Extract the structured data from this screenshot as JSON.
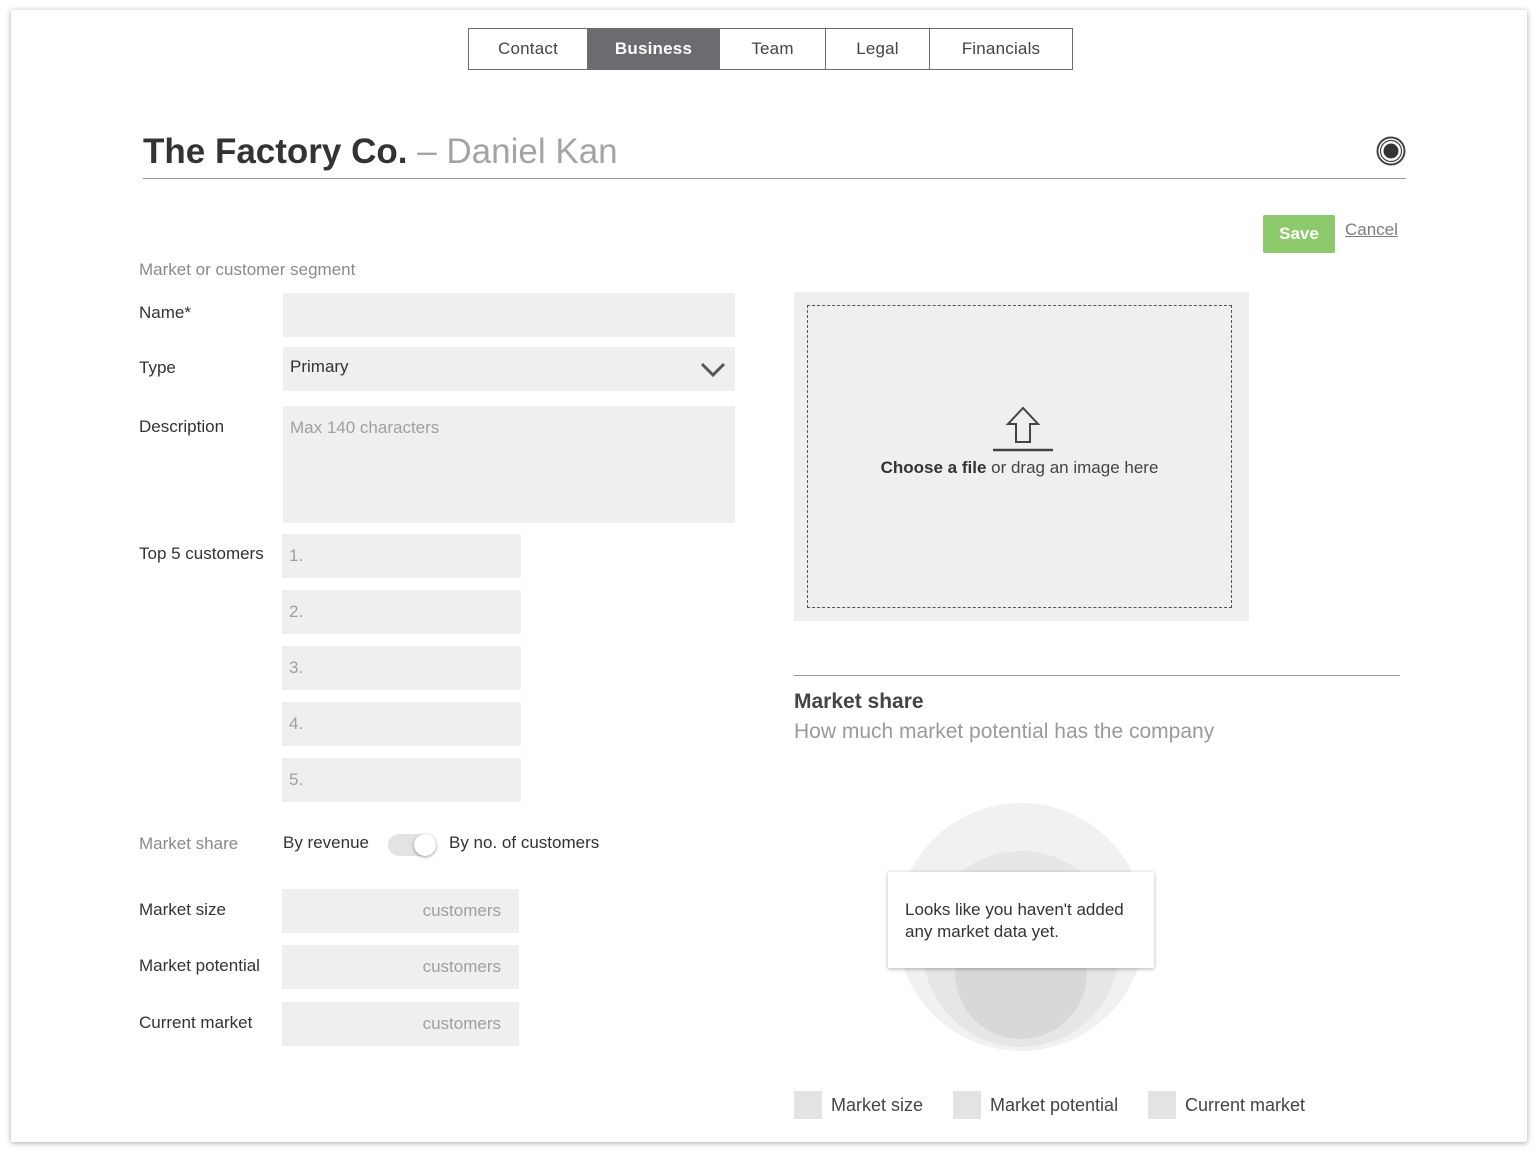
{
  "tabs": [
    {
      "label": "Contact",
      "active": false
    },
    {
      "label": "Business",
      "active": true
    },
    {
      "label": "Team",
      "active": false
    },
    {
      "label": "Legal",
      "active": false
    },
    {
      "label": "Financials",
      "active": false
    }
  ],
  "header": {
    "company": "The Factory Co.",
    "separator": " – ",
    "person": "Daniel Kan",
    "icon": "record-icon"
  },
  "actions": {
    "save_label": "Save",
    "cancel_label": "Cancel"
  },
  "form": {
    "section_label": "Market or customer segment",
    "name_label": "Name*",
    "name_value": "",
    "type_label": "Type",
    "type_value": "Primary",
    "description_label": "Description",
    "description_placeholder": "Max 140 characters",
    "top_customers_label": "Top 5 customers",
    "top_customers_placeholders": [
      "1.",
      "2.",
      "3.",
      "4.",
      "5."
    ],
    "market_share_label": "Market share",
    "toggle_left": "By revenue",
    "toggle_right": "By no. of customers",
    "market_size_label": "Market size",
    "market_potential_label": "Market potential",
    "current_market_label": "Current market",
    "unit_placeholder": "customers"
  },
  "upload": {
    "choose_text": "Choose a file",
    "rest_text": " or drag an image here",
    "icon": "upload-arrow-icon"
  },
  "market_share_panel": {
    "title": "Market share",
    "subtitle": "How much market potential has the company",
    "empty_message": "Looks like you haven't added any market data yet.",
    "legend": [
      "Market size",
      "Market potential",
      "Current market"
    ]
  },
  "colors": {
    "accent_save": "#8cc96a",
    "tab_active_bg": "#6b6b70",
    "field_bg": "#efefef",
    "legend_swatch": "#e3e3e3"
  }
}
